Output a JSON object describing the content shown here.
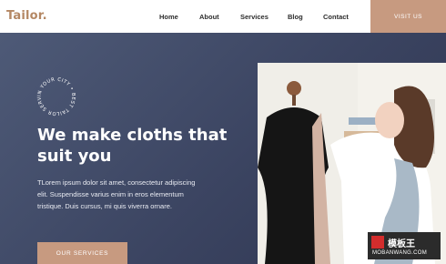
{
  "nav": {
    "logo": "Tailor.",
    "links": [
      "Home",
      "About",
      "Services",
      "Blog",
      "Contact"
    ],
    "visit_label": "VISIT US"
  },
  "hero": {
    "badge_text": "IN YOUR CITY • BEST TAILOR SERVICES •",
    "headline_line1": "We make cloths that",
    "headline_line2": "suit you",
    "paragraph": "TLorem ipsum dolor sit amet, consectetur adipiscing elit. Suspendisse varius enim in eros elementum tristique. Duis cursus, mi quis viverra ornare.",
    "cta_label": "OUR SERVICES"
  },
  "watermark": {
    "brand_cn": "模板王",
    "domain": "MOBANWANG.COM"
  }
}
